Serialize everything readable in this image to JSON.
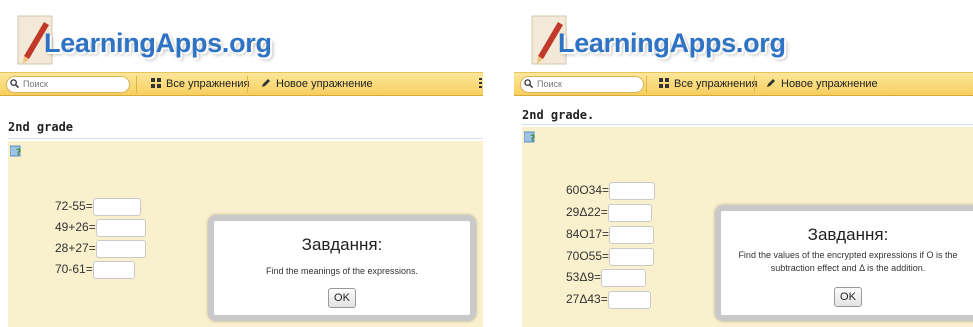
{
  "left": {
    "logo": "LearningApps.org",
    "nav": {
      "search_placeholder": "Поиск",
      "all_exercises": "Все упражнения",
      "new_exercise": "Новое упражнение"
    },
    "title": "2nd grade",
    "expressions": [
      "72-55=",
      "49+26=",
      "28+27=",
      "70-61="
    ],
    "dialog": {
      "title": "Завдання:",
      "text": "Find the meanings of the expressions.",
      "ok": "OK"
    }
  },
  "right": {
    "logo": "LearningApps.org",
    "nav": {
      "search_placeholder": "Поиск",
      "all_exercises": "Все упражнения",
      "new_exercise": "Новое упражнение"
    },
    "title": "2nd grade.",
    "expressions": [
      "60O34=",
      "29Δ22=",
      "84O17=",
      "70O55=",
      "53Δ9=",
      "27Δ43="
    ],
    "dialog": {
      "title": "Завдання:",
      "text": "Find the values of the encrypted expressions if O is the subtraction effect and Δ is the addition.",
      "ok": "OK"
    }
  },
  "colors": {
    "logo_blue": "#2f74c4",
    "navbar_yellow": "#f6cf5e",
    "task_bg": "#f9f1cd"
  }
}
